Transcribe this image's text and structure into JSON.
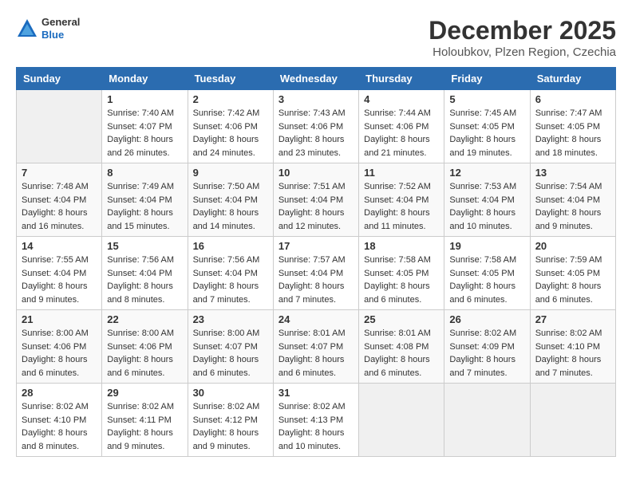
{
  "logo": {
    "general": "General",
    "blue": "Blue"
  },
  "title": "December 2025",
  "location": "Holoubkov, Plzen Region, Czechia",
  "days_of_week": [
    "Sunday",
    "Monday",
    "Tuesday",
    "Wednesday",
    "Thursday",
    "Friday",
    "Saturday"
  ],
  "weeks": [
    [
      {
        "day": null,
        "info": null
      },
      {
        "day": "1",
        "info": "Sunrise: 7:40 AM\nSunset: 4:07 PM\nDaylight: 8 hours\nand 26 minutes."
      },
      {
        "day": "2",
        "info": "Sunrise: 7:42 AM\nSunset: 4:06 PM\nDaylight: 8 hours\nand 24 minutes."
      },
      {
        "day": "3",
        "info": "Sunrise: 7:43 AM\nSunset: 4:06 PM\nDaylight: 8 hours\nand 23 minutes."
      },
      {
        "day": "4",
        "info": "Sunrise: 7:44 AM\nSunset: 4:06 PM\nDaylight: 8 hours\nand 21 minutes."
      },
      {
        "day": "5",
        "info": "Sunrise: 7:45 AM\nSunset: 4:05 PM\nDaylight: 8 hours\nand 19 minutes."
      },
      {
        "day": "6",
        "info": "Sunrise: 7:47 AM\nSunset: 4:05 PM\nDaylight: 8 hours\nand 18 minutes."
      }
    ],
    [
      {
        "day": "7",
        "info": "Sunrise: 7:48 AM\nSunset: 4:04 PM\nDaylight: 8 hours\nand 16 minutes."
      },
      {
        "day": "8",
        "info": "Sunrise: 7:49 AM\nSunset: 4:04 PM\nDaylight: 8 hours\nand 15 minutes."
      },
      {
        "day": "9",
        "info": "Sunrise: 7:50 AM\nSunset: 4:04 PM\nDaylight: 8 hours\nand 14 minutes."
      },
      {
        "day": "10",
        "info": "Sunrise: 7:51 AM\nSunset: 4:04 PM\nDaylight: 8 hours\nand 12 minutes."
      },
      {
        "day": "11",
        "info": "Sunrise: 7:52 AM\nSunset: 4:04 PM\nDaylight: 8 hours\nand 11 minutes."
      },
      {
        "day": "12",
        "info": "Sunrise: 7:53 AM\nSunset: 4:04 PM\nDaylight: 8 hours\nand 10 minutes."
      },
      {
        "day": "13",
        "info": "Sunrise: 7:54 AM\nSunset: 4:04 PM\nDaylight: 8 hours\nand 9 minutes."
      }
    ],
    [
      {
        "day": "14",
        "info": "Sunrise: 7:55 AM\nSunset: 4:04 PM\nDaylight: 8 hours\nand 9 minutes."
      },
      {
        "day": "15",
        "info": "Sunrise: 7:56 AM\nSunset: 4:04 PM\nDaylight: 8 hours\nand 8 minutes."
      },
      {
        "day": "16",
        "info": "Sunrise: 7:56 AM\nSunset: 4:04 PM\nDaylight: 8 hours\nand 7 minutes."
      },
      {
        "day": "17",
        "info": "Sunrise: 7:57 AM\nSunset: 4:04 PM\nDaylight: 8 hours\nand 7 minutes."
      },
      {
        "day": "18",
        "info": "Sunrise: 7:58 AM\nSunset: 4:05 PM\nDaylight: 8 hours\nand 6 minutes."
      },
      {
        "day": "19",
        "info": "Sunrise: 7:58 AM\nSunset: 4:05 PM\nDaylight: 8 hours\nand 6 minutes."
      },
      {
        "day": "20",
        "info": "Sunrise: 7:59 AM\nSunset: 4:05 PM\nDaylight: 8 hours\nand 6 minutes."
      }
    ],
    [
      {
        "day": "21",
        "info": "Sunrise: 8:00 AM\nSunset: 4:06 PM\nDaylight: 8 hours\nand 6 minutes."
      },
      {
        "day": "22",
        "info": "Sunrise: 8:00 AM\nSunset: 4:06 PM\nDaylight: 8 hours\nand 6 minutes."
      },
      {
        "day": "23",
        "info": "Sunrise: 8:00 AM\nSunset: 4:07 PM\nDaylight: 8 hours\nand 6 minutes."
      },
      {
        "day": "24",
        "info": "Sunrise: 8:01 AM\nSunset: 4:07 PM\nDaylight: 8 hours\nand 6 minutes."
      },
      {
        "day": "25",
        "info": "Sunrise: 8:01 AM\nSunset: 4:08 PM\nDaylight: 8 hours\nand 6 minutes."
      },
      {
        "day": "26",
        "info": "Sunrise: 8:02 AM\nSunset: 4:09 PM\nDaylight: 8 hours\nand 7 minutes."
      },
      {
        "day": "27",
        "info": "Sunrise: 8:02 AM\nSunset: 4:10 PM\nDaylight: 8 hours\nand 7 minutes."
      }
    ],
    [
      {
        "day": "28",
        "info": "Sunrise: 8:02 AM\nSunset: 4:10 PM\nDaylight: 8 hours\nand 8 minutes."
      },
      {
        "day": "29",
        "info": "Sunrise: 8:02 AM\nSunset: 4:11 PM\nDaylight: 8 hours\nand 9 minutes."
      },
      {
        "day": "30",
        "info": "Sunrise: 8:02 AM\nSunset: 4:12 PM\nDaylight: 8 hours\nand 9 minutes."
      },
      {
        "day": "31",
        "info": "Sunrise: 8:02 AM\nSunset: 4:13 PM\nDaylight: 8 hours\nand 10 minutes."
      },
      {
        "day": null,
        "info": null
      },
      {
        "day": null,
        "info": null
      },
      {
        "day": null,
        "info": null
      }
    ]
  ]
}
